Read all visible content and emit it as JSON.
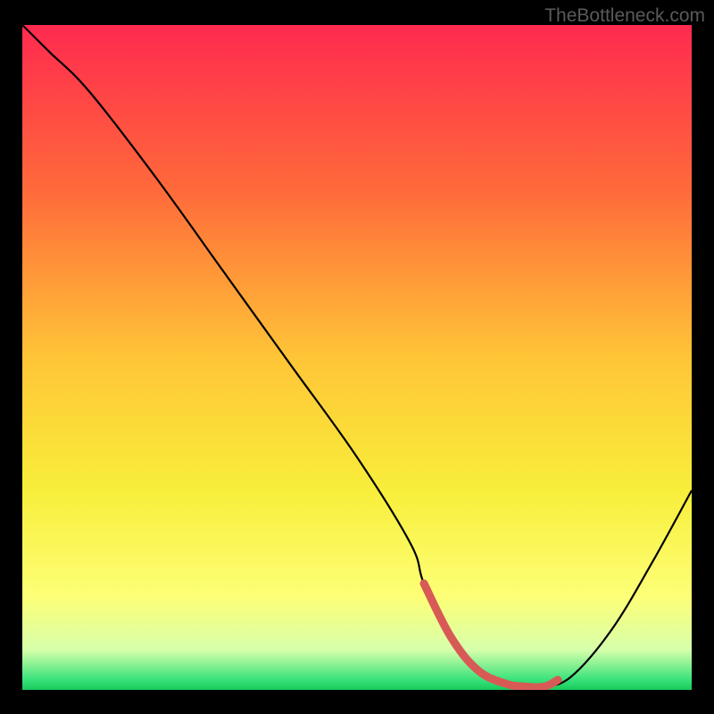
{
  "watermark": "TheBottleneck.com",
  "chart_data": {
    "type": "line",
    "title": "",
    "xlabel": "",
    "ylabel": "",
    "x_range": [
      0,
      100
    ],
    "y_range": [
      0,
      100
    ],
    "gradient_stops": [
      {
        "offset": 0,
        "color": "#ff2a4f"
      },
      {
        "offset": 0.25,
        "color": "#ff6a3a"
      },
      {
        "offset": 0.5,
        "color": "#ffc537"
      },
      {
        "offset": 0.7,
        "color": "#f8ee3a"
      },
      {
        "offset": 0.86,
        "color": "#fdff77"
      },
      {
        "offset": 0.94,
        "color": "#d7ffab"
      },
      {
        "offset": 0.985,
        "color": "#38e27a"
      },
      {
        "offset": 1.0,
        "color": "#18c95a"
      }
    ],
    "curve": {
      "name": "bottleneck-curve",
      "color": "#000000",
      "x": [
        0,
        4,
        10,
        20,
        30,
        40,
        50,
        58,
        60,
        64,
        68,
        72,
        75,
        78,
        82,
        88,
        94,
        100
      ],
      "y": [
        100,
        96,
        90,
        77,
        63,
        49,
        35,
        22,
        16,
        8,
        3,
        1,
        0.5,
        0.5,
        2,
        9,
        19,
        30
      ]
    },
    "highlight_segment": {
      "name": "optimal-range",
      "color": "#d85a56",
      "width": 9,
      "x": [
        60,
        64,
        68,
        72,
        75,
        78,
        80
      ],
      "y": [
        16,
        8,
        3,
        1,
        0.5,
        0.5,
        1.5
      ]
    }
  }
}
